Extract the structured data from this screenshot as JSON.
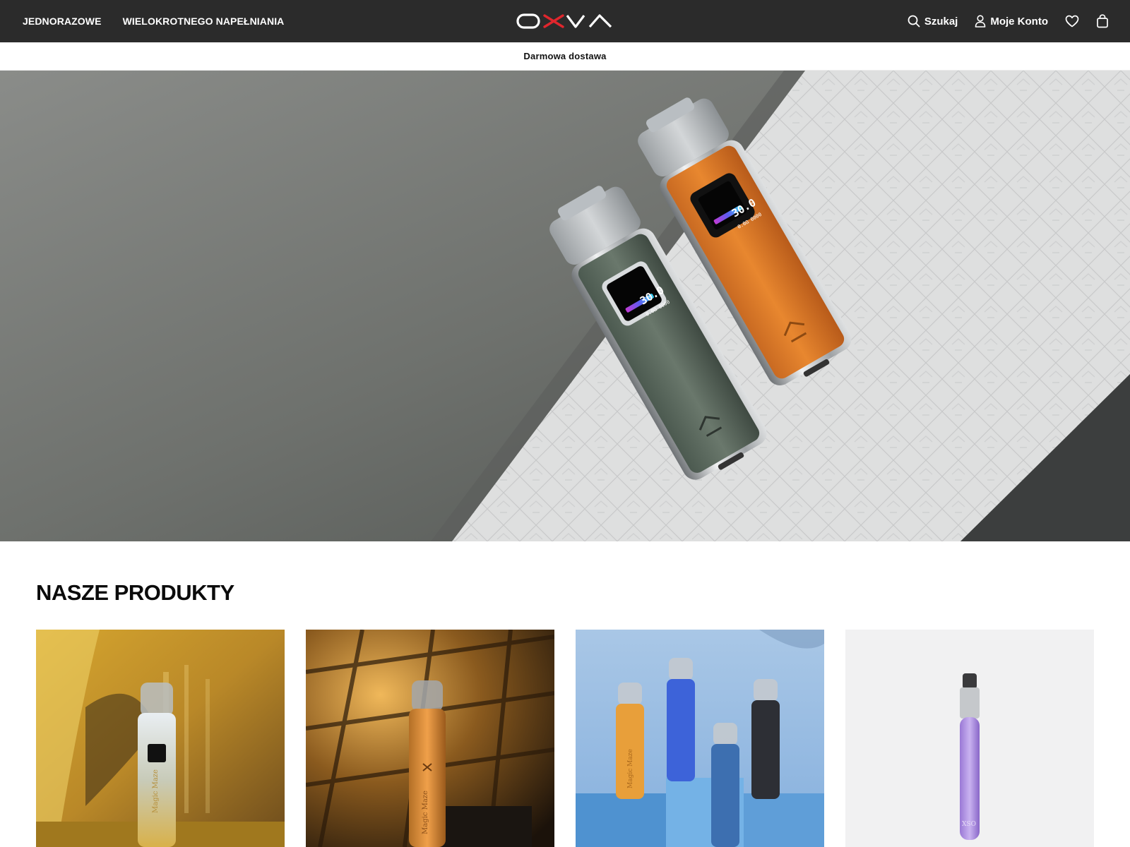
{
  "header": {
    "nav_left": [
      {
        "label": "JEDNORAZOWE"
      },
      {
        "label": "WIELOKROTNEGO NAPEŁNIANIA"
      }
    ],
    "logo_text": "OXVA",
    "search_label": "Szukaj",
    "account_label": "Moje Konto",
    "icons": [
      "search-icon",
      "user-icon",
      "heart-icon",
      "bag-icon"
    ]
  },
  "announcement": {
    "text": "Darmowa dostawa"
  },
  "hero": {
    "device_screen_value": "30.0",
    "device_screen_sub": "0.0Ω 0000"
  },
  "products": {
    "title": "NASZE PRODUKTY",
    "items": [
      {
        "image_text": "Magic Maze"
      },
      {
        "image_text": "Magic Maze"
      },
      {
        "image_text": "Magic Maze"
      },
      {
        "image_text": "XSO"
      }
    ]
  },
  "colors": {
    "header_bg": "#2b2b2b",
    "accent_red": "#e0262d",
    "text_dark": "#0b0b0b"
  }
}
